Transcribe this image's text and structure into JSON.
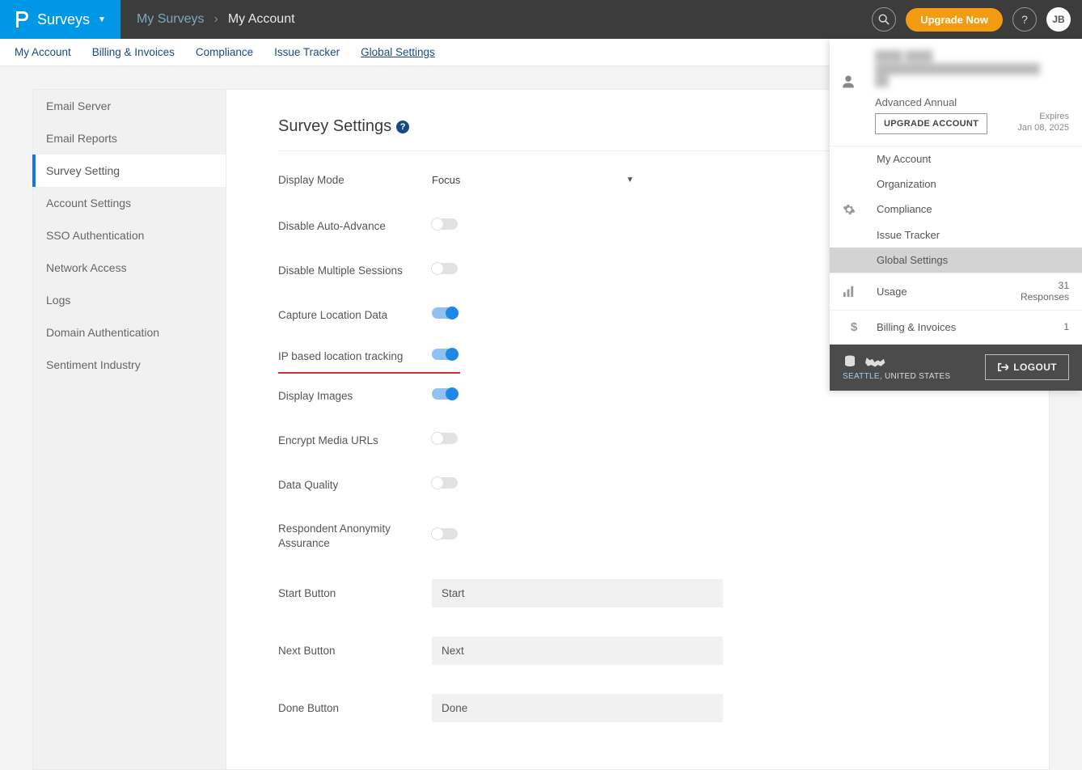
{
  "header": {
    "brand": "Surveys",
    "breadcrumb_root": "My Surveys",
    "breadcrumb_current": "My Account",
    "upgrade": "Upgrade Now",
    "avatar": "JB"
  },
  "subnav": {
    "items": [
      "My Account",
      "Billing & Invoices",
      "Compliance",
      "Issue Tracker",
      "Global Settings"
    ],
    "active_index": 4
  },
  "sidebar": {
    "items": [
      "Email Server",
      "Email Reports",
      "Survey Setting",
      "Account Settings",
      "SSO Authentication",
      "Network Access",
      "Logs",
      "Domain Authentication",
      "Sentiment Industry"
    ],
    "active_index": 2
  },
  "section": {
    "title": "Survey Settings"
  },
  "settings": {
    "display_mode": {
      "label": "Display Mode",
      "value": "Focus"
    },
    "disable_auto_advance": {
      "label": "Disable Auto-Advance",
      "on": false
    },
    "disable_multiple_sessions": {
      "label": "Disable Multiple Sessions",
      "on": false
    },
    "capture_location": {
      "label": "Capture Location Data",
      "on": true
    },
    "ip_location": {
      "label": "IP based location tracking",
      "on": true,
      "highlight": true
    },
    "display_images": {
      "label": "Display Images",
      "on": true
    },
    "encrypt_media": {
      "label": "Encrypt Media URLs",
      "on": false
    },
    "data_quality": {
      "label": "Data Quality",
      "on": false
    },
    "anonymity": {
      "label": "Respondent Anonymity Assurance",
      "on": false
    },
    "start_button": {
      "label": "Start Button",
      "value": "Start"
    },
    "next_button": {
      "label": "Next Button",
      "value": "Next"
    },
    "done_button": {
      "label": "Done Button",
      "value": "Done"
    }
  },
  "account_panel": {
    "plan": "Advanced Annual",
    "expires_label": "Expires",
    "expires_date": "Jan 08, 2025",
    "upgrade": "UPGRADE ACCOUNT",
    "menu": [
      "My Account",
      "Organization",
      "Compliance",
      "Issue Tracker",
      "Global Settings"
    ],
    "menu_active_index": 4,
    "usage": {
      "label": "Usage",
      "count": "31",
      "unit": "Responses"
    },
    "billing": {
      "label": "Billing & Invoices",
      "count": "1"
    },
    "location_city": "SEATTLE,",
    "location_rest": " UNITED STATES",
    "logout": "LOGOUT"
  }
}
